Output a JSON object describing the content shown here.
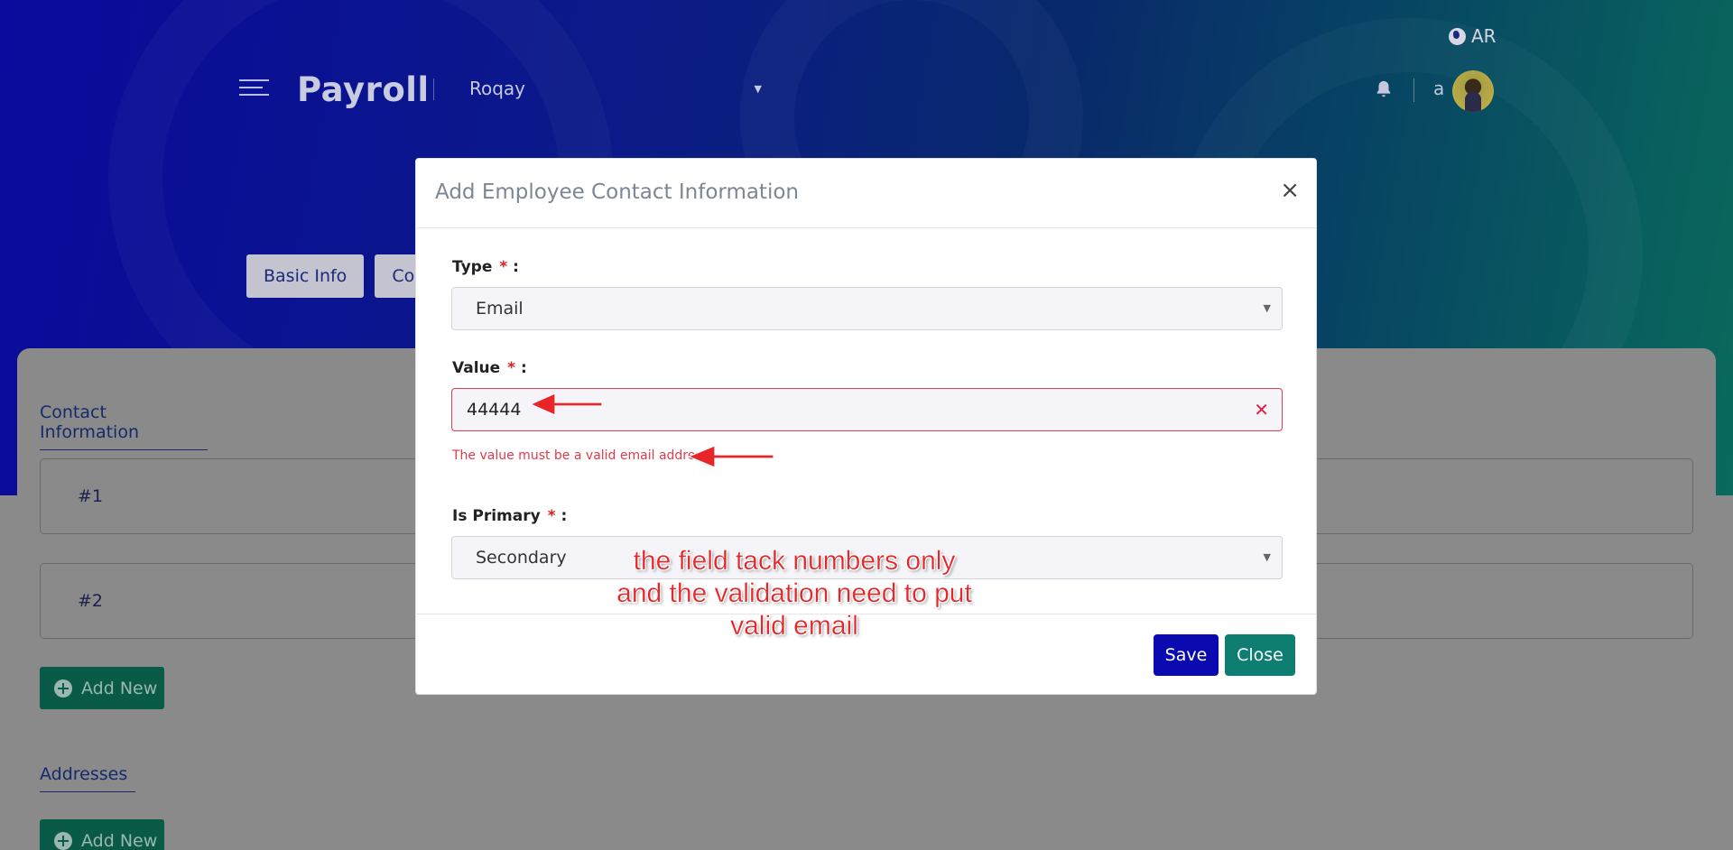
{
  "header": {
    "language_toggle": "AR",
    "brand": "Payroll",
    "company": "Roqay",
    "user_initial": "a"
  },
  "tabs": [
    {
      "label": "Basic Info"
    },
    {
      "label": "Com"
    }
  ],
  "content": {
    "contact_section_title": "Contact Information",
    "contact_rows": [
      {
        "label": "#1"
      },
      {
        "label": "#2"
      }
    ],
    "add_new_label": "Add New",
    "addresses_section_title": "Addresses",
    "add_new_address_label": "Add New"
  },
  "modal": {
    "title": "Add Employee Contact Information",
    "close_glyph": "×",
    "type_label": "Type",
    "type_value": "Email",
    "value_label": "Value",
    "value_input": "44444",
    "value_error": "The value must be a valid email address.",
    "primary_label": "Is Primary",
    "primary_value": "Secondary",
    "required_mark": "*",
    "colon": ":",
    "save_label": "Save",
    "close_label": "Close"
  },
  "annotation": {
    "line1": "the field tack numbers only",
    "line2": "and the validation need to put",
    "line3": "valid email"
  },
  "colors": {
    "save_button": "#0a0ab0",
    "close_button": "#0e7e72",
    "error": "#e03a4a",
    "annotation": "#e8262a"
  }
}
